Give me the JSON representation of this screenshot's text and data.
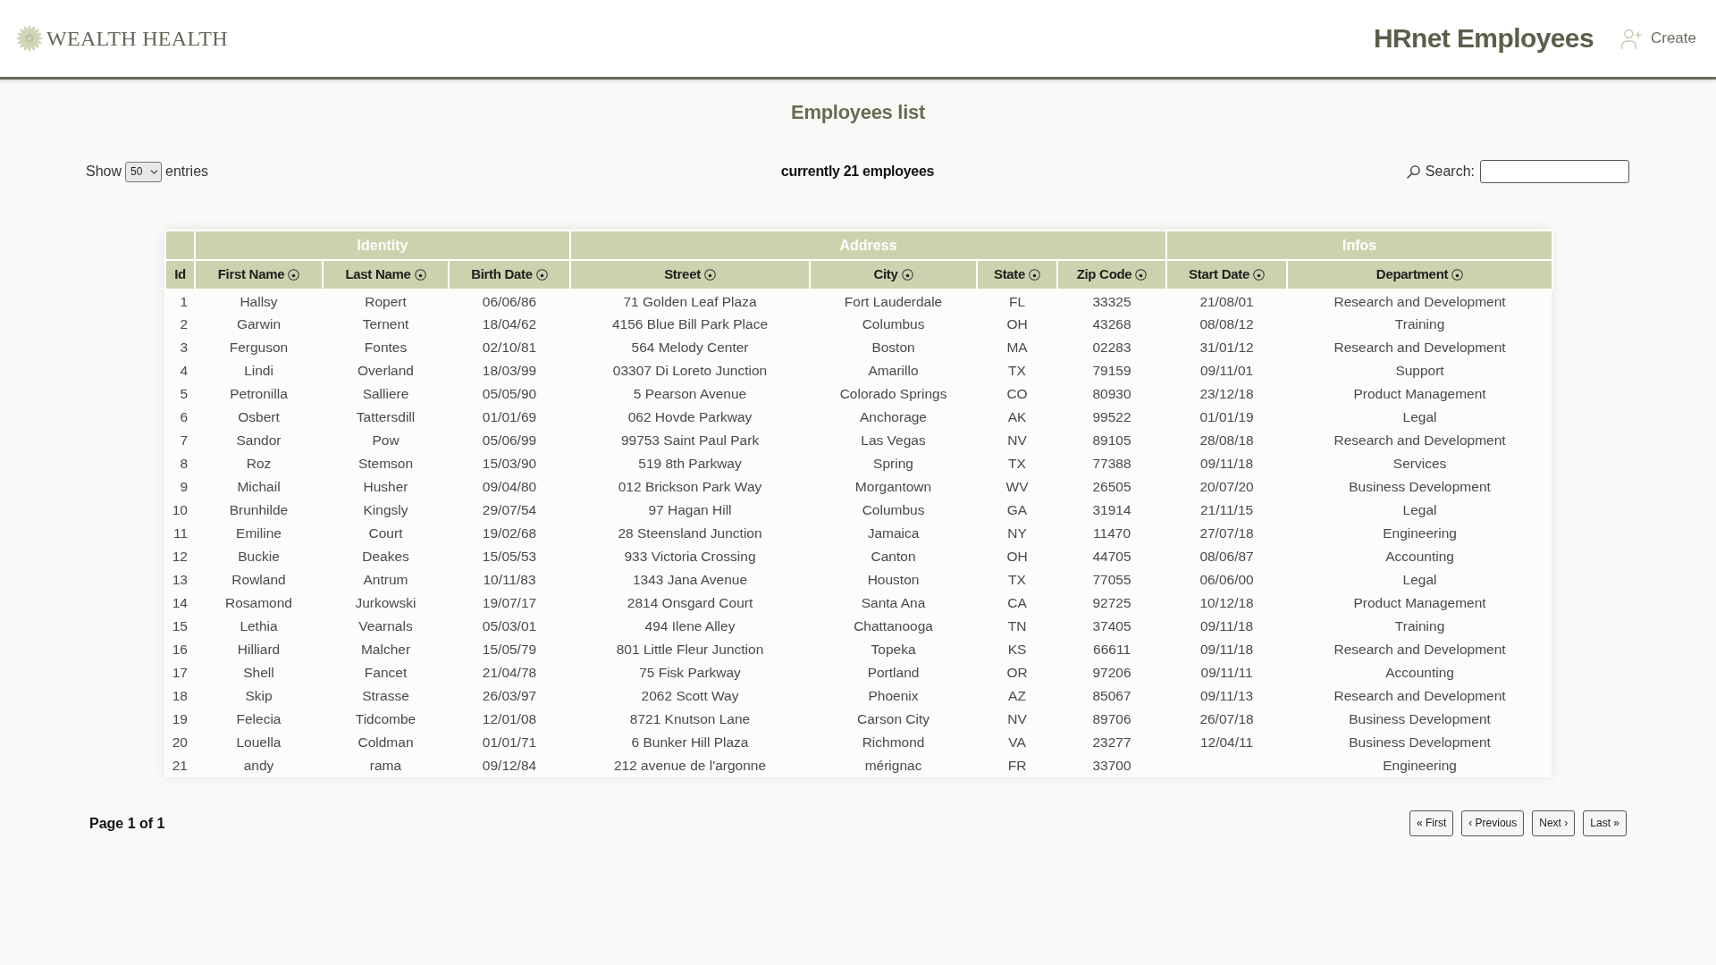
{
  "header": {
    "logo_text": "WEALTH HEALTH",
    "title": "HRnet Employees",
    "nav": [
      {
        "label": "Create"
      }
    ]
  },
  "page_title": "Employees list",
  "controls": {
    "show_label": "Show",
    "page_size": "50",
    "entries_label": "entries",
    "count_text": "currently 21 employees",
    "search": {
      "label": "Search:"
    }
  },
  "table": {
    "column_groups": [
      {
        "columns": [
          {
            "label": "Id",
            "sortable": false
          }
        ]
      },
      {
        "label": "Identity",
        "columns": [
          {
            "label": "First Name",
            "sortable": true
          },
          {
            "label": "Last Name",
            "sortable": true
          },
          {
            "label": "Birth Date",
            "sortable": true
          }
        ]
      },
      {
        "label": "Address",
        "columns": [
          {
            "label": "Street",
            "sortable": true
          },
          {
            "label": "City",
            "sortable": true
          },
          {
            "label": "State",
            "sortable": true
          },
          {
            "label": "Zip Code",
            "sortable": true
          }
        ]
      },
      {
        "label": "Infos",
        "columns": [
          {
            "label": "Start Date",
            "sortable": true
          },
          {
            "label": "Department",
            "sortable": true
          }
        ]
      }
    ],
    "rows": [
      [
        "1",
        "Hallsy",
        "Ropert",
        "06/06/86",
        "71 Golden Leaf Plaza",
        "Fort Lauderdale",
        "FL",
        "33325",
        "21/08/01",
        "Research and Development"
      ],
      [
        "2",
        "Garwin",
        "Ternent",
        "18/04/62",
        "4156 Blue Bill Park Place",
        "Columbus",
        "OH",
        "43268",
        "08/08/12",
        "Training"
      ],
      [
        "3",
        "Ferguson",
        "Fontes",
        "02/10/81",
        "564 Melody Center",
        "Boston",
        "MA",
        "02283",
        "31/01/12",
        "Research and Development"
      ],
      [
        "4",
        "Lindi",
        "Overland",
        "18/03/99",
        "03307 Di Loreto Junction",
        "Amarillo",
        "TX",
        "79159",
        "09/11/01",
        "Support"
      ],
      [
        "5",
        "Petronilla",
        "Salliere",
        "05/05/90",
        "5 Pearson Avenue",
        "Colorado Springs",
        "CO",
        "80930",
        "23/12/18",
        "Product Management"
      ],
      [
        "6",
        "Osbert",
        "Tattersdill",
        "01/01/69",
        "062 Hovde Parkway",
        "Anchorage",
        "AK",
        "99522",
        "01/01/19",
        "Legal"
      ],
      [
        "7",
        "Sandor",
        "Pow",
        "05/06/99",
        "99753 Saint Paul Park",
        "Las Vegas",
        "NV",
        "89105",
        "28/08/18",
        "Research and Development"
      ],
      [
        "8",
        "Roz",
        "Stemson",
        "15/03/90",
        "519 8th Parkway",
        "Spring",
        "TX",
        "77388",
        "09/11/18",
        "Services"
      ],
      [
        "9",
        "Michail",
        "Husher",
        "09/04/80",
        "012 Brickson Park Way",
        "Morgantown",
        "WV",
        "26505",
        "20/07/20",
        "Business Development"
      ],
      [
        "10",
        "Brunhilde",
        "Kingsly",
        "29/07/54",
        "97 Hagan Hill",
        "Columbus",
        "GA",
        "31914",
        "21/11/15",
        "Legal"
      ],
      [
        "11",
        "Emiline",
        "Court",
        "19/02/68",
        "28 Steensland Junction",
        "Jamaica",
        "NY",
        "11470",
        "27/07/18",
        "Engineering"
      ],
      [
        "12",
        "Buckie",
        "Deakes",
        "15/05/53",
        "933 Victoria Crossing",
        "Canton",
        "OH",
        "44705",
        "08/06/87",
        "Accounting"
      ],
      [
        "13",
        "Rowland",
        "Antrum",
        "10/11/83",
        "1343 Jana Avenue",
        "Houston",
        "TX",
        "77055",
        "06/06/00",
        "Legal"
      ],
      [
        "14",
        "Rosamond",
        "Jurkowski",
        "19/07/17",
        "2814 Onsgard Court",
        "Santa Ana",
        "CA",
        "92725",
        "10/12/18",
        "Product Management"
      ],
      [
        "15",
        "Lethia",
        "Vearnals",
        "05/03/01",
        "494 Ilene Alley",
        "Chattanooga",
        "TN",
        "37405",
        "09/11/18",
        "Training"
      ],
      [
        "16",
        "Hilliard",
        "Malcher",
        "15/05/79",
        "801 Little Fleur Junction",
        "Topeka",
        "KS",
        "66611",
        "09/11/18",
        "Research and Development"
      ],
      [
        "17",
        "Shell",
        "Fancet",
        "21/04/78",
        "75 Fisk Parkway",
        "Portland",
        "OR",
        "97206",
        "09/11/11",
        "Accounting"
      ],
      [
        "18",
        "Skip",
        "Strasse",
        "26/03/97",
        "2062 Scott Way",
        "Phoenix",
        "AZ",
        "85067",
        "09/11/13",
        "Research and Development"
      ],
      [
        "19",
        "Felecia",
        "Tidcombe",
        "12/01/08",
        "8721 Knutson Lane",
        "Carson City",
        "NV",
        "89706",
        "26/07/18",
        "Business Development"
      ],
      [
        "20",
        "Louella",
        "Coldman",
        "01/01/71",
        "6 Bunker Hill Plaza",
        "Richmond",
        "VA",
        "23277",
        "12/04/11",
        "Business Development"
      ],
      [
        "21",
        "andy",
        "rama",
        "09/12/84",
        "212 avenue de l'argonne",
        "mérignac",
        "FR",
        "33700",
        null,
        "Engineering"
      ]
    ]
  },
  "pagination": {
    "page_info": "Page 1 of 1",
    "buttons": [
      {
        "label": "« First"
      },
      {
        "label": "‹ Previous"
      },
      {
        "label": "Next ›"
      },
      {
        "label": "Last »"
      }
    ]
  }
}
